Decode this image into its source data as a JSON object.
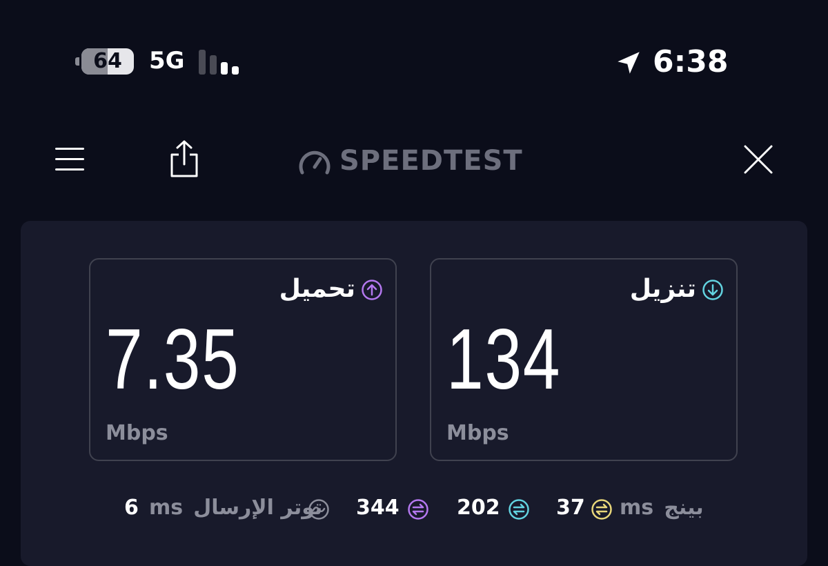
{
  "status_bar": {
    "battery_level": "64",
    "network": "5G",
    "time": "6:38",
    "icons": [
      "battery-icon",
      "cellular-signal-icon",
      "location-arrow-icon"
    ]
  },
  "nav": {
    "logo_text": "SPEEDTEST",
    "icons": [
      "menu-icon",
      "share-icon",
      "speedometer-icon",
      "close-icon"
    ]
  },
  "results": {
    "upload": {
      "label": "تحميل",
      "value": "7.35",
      "unit": "Mbps",
      "icon": "upload-arrow-icon",
      "color": "#b478f0"
    },
    "download": {
      "label": "تنزيل",
      "value": "134",
      "unit": "Mbps",
      "icon": "download-arrow-icon",
      "color": "#62d3e0"
    }
  },
  "metrics": {
    "ping_label": "بينج",
    "ping_unit": "ms",
    "ping_idle": "37",
    "ping_download": "202",
    "ping_upload": "344",
    "jitter_label": "توتر الإرسال",
    "jitter_unit": "ms",
    "jitter_value": "6"
  },
  "colors": {
    "background": "#0b0d1a",
    "panel": "#181a2b",
    "idle_ping": "#e9d77a",
    "download_ping": "#62d3e0",
    "upload_ping": "#b478f0"
  }
}
